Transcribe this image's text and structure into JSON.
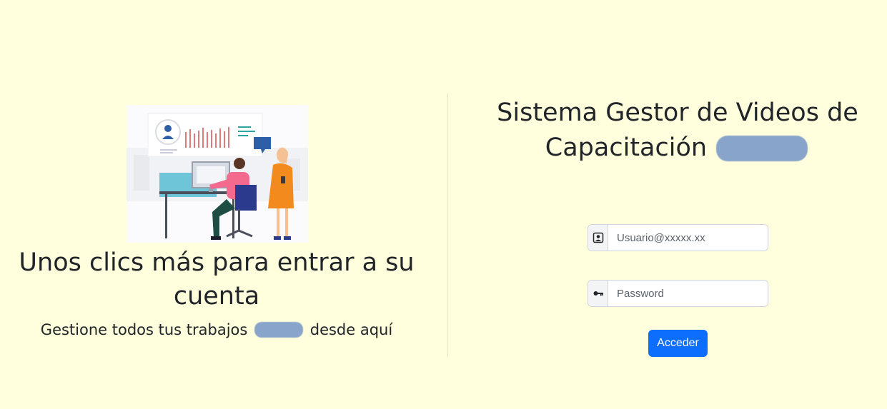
{
  "left": {
    "headline": "Unos clics más para entrar a su cuenta",
    "tagline_start": "Gestione todos tus trabajos",
    "tagline_end": "desde aquí"
  },
  "right": {
    "title": "Sistema Gestor de Videos de Capacitación"
  },
  "form": {
    "user": {
      "placeholder": "Usuario@xxxxx.xx",
      "icon": "person-badge-icon"
    },
    "password": {
      "placeholder": "Password",
      "icon": "key-icon"
    },
    "submit_label": "Acceder"
  },
  "colors": {
    "background": "#ffffdd",
    "primary": "#0d6efd",
    "text": "#212529"
  }
}
